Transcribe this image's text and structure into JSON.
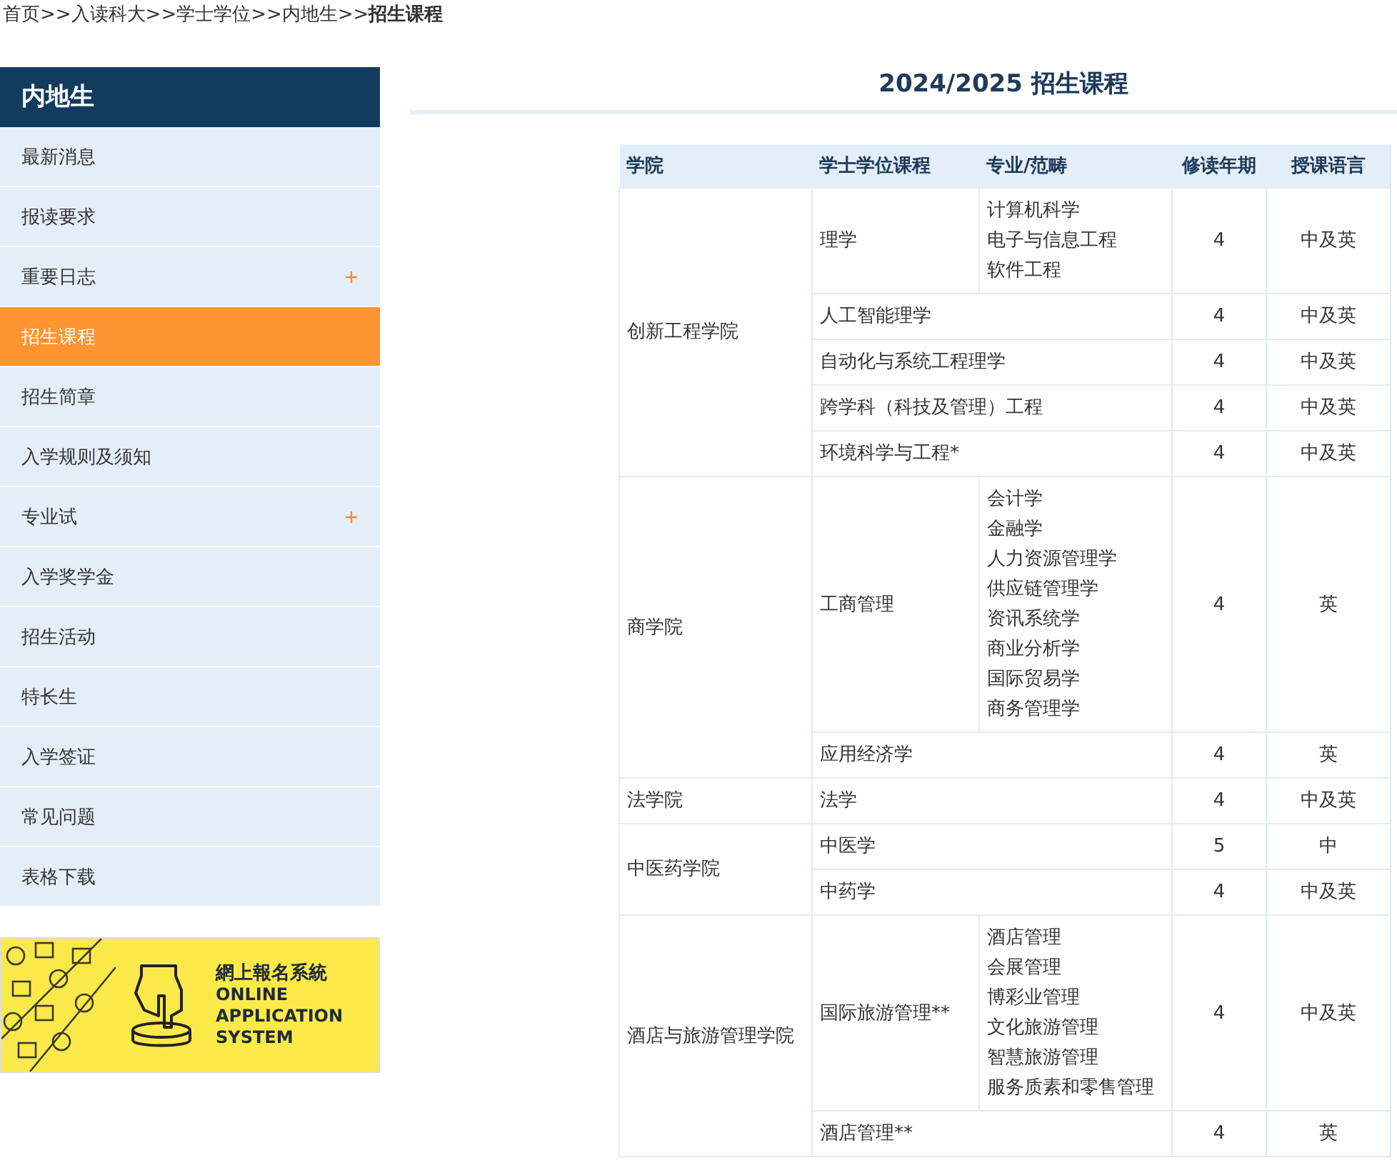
{
  "breadcrumb": {
    "links": [
      "首页",
      "入读科大",
      "学士学位",
      "内地生"
    ],
    "separator": ">>",
    "current": "招生课程"
  },
  "sidebar": {
    "title": "内地生",
    "items": [
      {
        "label": "最新消息",
        "selected": false,
        "expandable": false
      },
      {
        "label": "报读要求",
        "selected": false,
        "expandable": false
      },
      {
        "label": "重要日志",
        "selected": false,
        "expandable": true
      },
      {
        "label": "招生课程",
        "selected": true,
        "expandable": false
      },
      {
        "label": "招生简章",
        "selected": false,
        "expandable": false
      },
      {
        "label": "入学规则及须知",
        "selected": false,
        "expandable": false
      },
      {
        "label": "专业试",
        "selected": false,
        "expandable": true
      },
      {
        "label": "入学奖学金",
        "selected": false,
        "expandable": false
      },
      {
        "label": "招生活动",
        "selected": false,
        "expandable": false
      },
      {
        "label": "特长生",
        "selected": false,
        "expandable": false
      },
      {
        "label": "入学签证",
        "selected": false,
        "expandable": false
      },
      {
        "label": "常见问题",
        "selected": false,
        "expandable": false
      },
      {
        "label": "表格下载",
        "selected": false,
        "expandable": false
      }
    ]
  },
  "banner": {
    "title": "網上報名系統",
    "subtitle": [
      "ONLINE",
      "APPLICATION",
      "SYSTEM"
    ]
  },
  "page_title": "2024/2025 招生课程",
  "table": {
    "columns": [
      "学院",
      "学士学位课程",
      "专业/范畴",
      "修读年期",
      "授课语言"
    ],
    "faculties": [
      {
        "name": "创新工程学院",
        "programmes": [
          {
            "name": "理学",
            "majors": [
              "计算机科学",
              "电子与信息工程",
              "软件工程"
            ],
            "years": "4",
            "language": "中及英"
          },
          {
            "name": "人工智能理学",
            "years": "4",
            "language": "中及英"
          },
          {
            "name": "自动化与系统工程理学",
            "years": "4",
            "language": "中及英"
          },
          {
            "name": "跨学科（科技及管理）工程",
            "years": "4",
            "language": "中及英"
          },
          {
            "name": "环境科学与工程*",
            "years": "4",
            "language": "中及英"
          }
        ]
      },
      {
        "name": "商学院",
        "programmes": [
          {
            "name": "工商管理",
            "majors": [
              "会计学",
              "金融学",
              "人力资源管理学",
              "供应链管理学",
              "资讯系统学",
              "商业分析学",
              "国际贸易学",
              "商务管理学"
            ],
            "years": "4",
            "language": "英"
          },
          {
            "name": "应用经济学",
            "years": "4",
            "language": "英"
          }
        ]
      },
      {
        "name": "法学院",
        "programmes": [
          {
            "name": "法学",
            "years": "4",
            "language": "中及英"
          }
        ]
      },
      {
        "name": "中医药学院",
        "programmes": [
          {
            "name": "中医学",
            "years": "5",
            "language": "中"
          },
          {
            "name": "中药学",
            "years": "4",
            "language": "中及英"
          }
        ]
      },
      {
        "name": "酒店与旅游管理学院",
        "programmes": [
          {
            "name": "国际旅游管理**",
            "majors": [
              "酒店管理",
              "会展管理",
              "博彩业管理",
              "文化旅游管理",
              "智慧旅游管理",
              "服务质素和零售管理"
            ],
            "years": "4",
            "language": "中及英"
          },
          {
            "name": "酒店管理**",
            "years": "4",
            "language": "英"
          }
        ]
      }
    ]
  }
}
